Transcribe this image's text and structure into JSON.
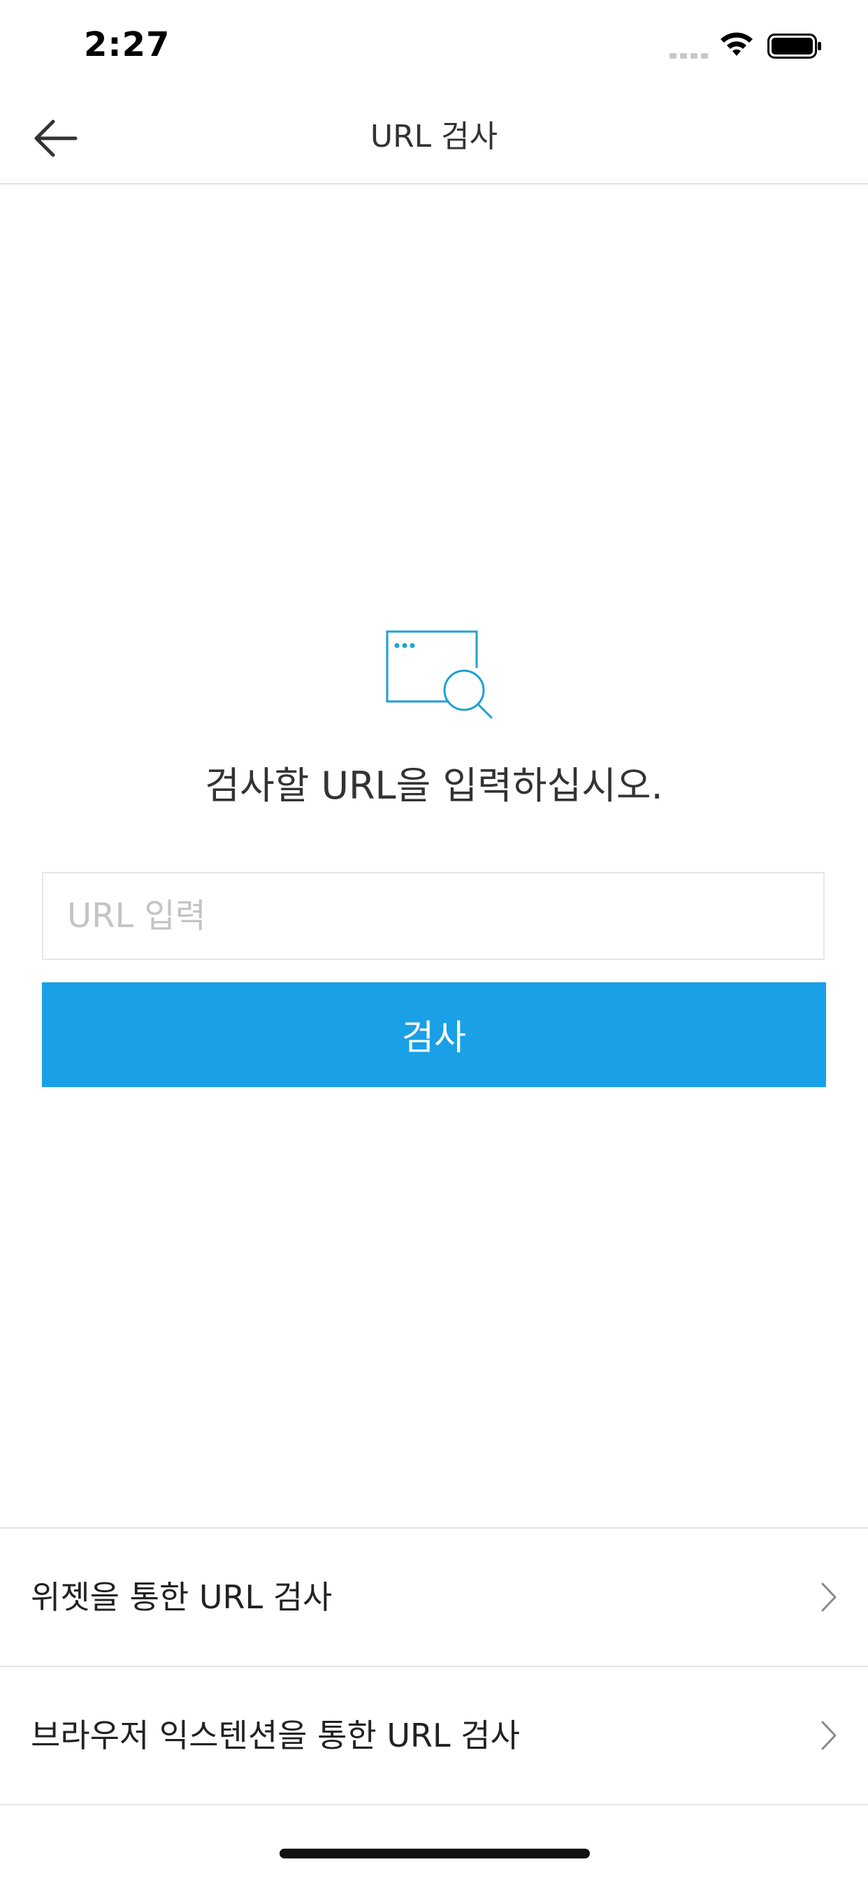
{
  "status_bar": {
    "time": "2:27"
  },
  "nav": {
    "title": "URL 검사"
  },
  "main": {
    "prompt": "검사할 URL을 입력하십시오.",
    "url_input_placeholder": "URL 입력",
    "url_input_value": "",
    "scan_button_label": "검사"
  },
  "list": {
    "items": [
      {
        "label": "위젯을 통한 URL 검사"
      },
      {
        "label": "브라우저 익스텐션을 통한 URL 검사"
      }
    ]
  },
  "colors": {
    "accent": "#1aa0e6",
    "icon": "#1ea0d8",
    "text": "#333333",
    "divider": "#e3e3e3"
  },
  "icons": {
    "back": "arrow-left-icon",
    "empty_state": "browser-search-icon",
    "list_chevron": "chevron-right-icon"
  }
}
